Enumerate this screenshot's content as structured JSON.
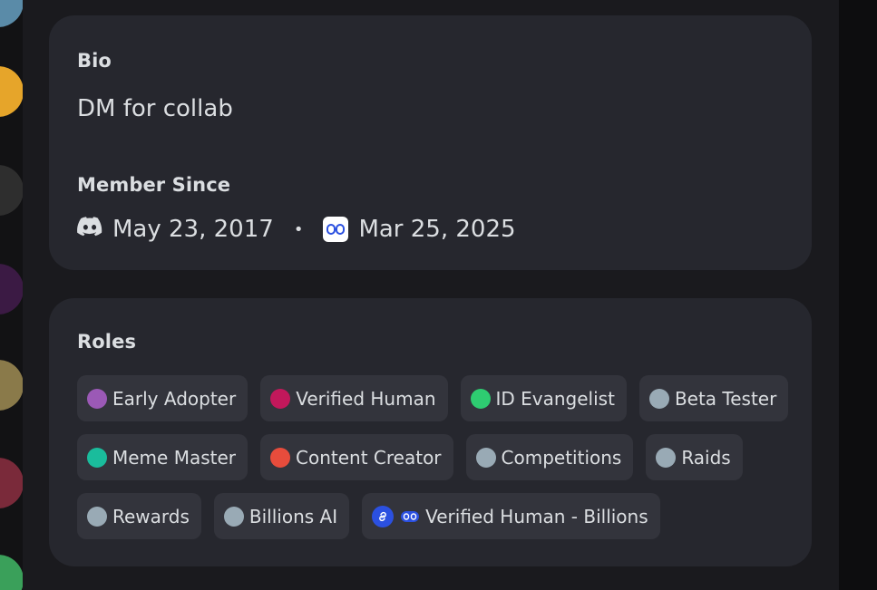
{
  "bio": {
    "heading": "Bio",
    "text": "DM for collab"
  },
  "member_since": {
    "heading": "Member Since",
    "discord_date": "May 23, 2017",
    "separator": "•",
    "server_date": "Mar 25, 2025"
  },
  "roles": {
    "heading": "Roles",
    "rows": [
      [
        {
          "label": "Early Adopter",
          "color": "#9b59b6"
        },
        {
          "label": "Verified Human",
          "color": "#c2185b"
        },
        {
          "label": "ID Evangelist",
          "color": "#2ecc71"
        },
        {
          "label": "Beta Tester",
          "color": "#99aab5"
        }
      ],
      [
        {
          "label": "Meme Master",
          "color": "#1abc9c"
        },
        {
          "label": "Content Creator",
          "color": "#e74c3c"
        },
        {
          "label": "Competitions",
          "color": "#99aab5"
        },
        {
          "label": "Raids",
          "color": "#99aab5"
        }
      ],
      [
        {
          "label": "Rewards",
          "color": "#99aab5"
        },
        {
          "label": "Billions AI",
          "color": "#99aab5"
        },
        {
          "label": "Verified Human - Billions",
          "color": "",
          "icon": "link-icon"
        }
      ]
    ]
  },
  "colors": {
    "card_bg": "#26272e",
    "role_bg": "#33343c",
    "text": "#dbdee1",
    "accent_blue": "#2b50e0"
  }
}
